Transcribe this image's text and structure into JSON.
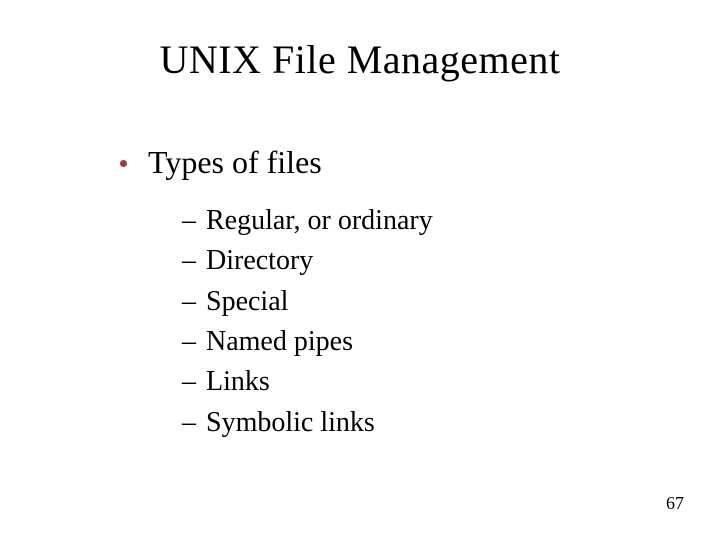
{
  "title": "UNIX File Management",
  "level1_label": "Types of files",
  "items": [
    "Regular, or ordinary",
    "Directory",
    "Special",
    "Named pipes",
    "Links",
    "Symbolic links"
  ],
  "page_number": "67"
}
